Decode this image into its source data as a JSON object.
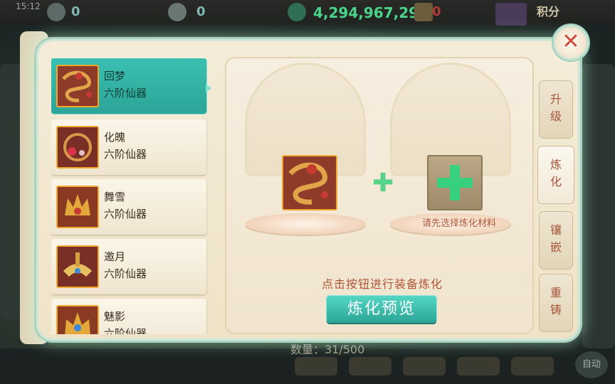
{
  "status_bar": {
    "time": "15:12",
    "currency_a": "0",
    "currency_b": "0",
    "gold": "4,294,967,295",
    "red_currency": "0",
    "points_label": "积分"
  },
  "background": {
    "count_text": "数量：31/500",
    "auto_label": "自动"
  },
  "item_list": [
    {
      "name": "回梦",
      "grade": "六阶仙器",
      "selected": true
    },
    {
      "name": "化魄",
      "grade": "六阶仙器",
      "selected": false
    },
    {
      "name": "舞雪",
      "grade": "六阶仙器",
      "selected": false
    },
    {
      "name": "邀月",
      "grade": "六阶仙器",
      "selected": false
    },
    {
      "name": "魅影",
      "grade": "六阶仙器",
      "selected": false
    }
  ],
  "refine": {
    "material_hint": "请先选择炼化材料",
    "action_hint": "点击按钮进行装备炼化",
    "preview_button": "炼化预览"
  },
  "tabs": [
    {
      "line1": "升",
      "line2": "级",
      "active": false
    },
    {
      "line1": "炼",
      "line2": "化",
      "active": true
    },
    {
      "line1": "镶",
      "line2": "嵌",
      "active": false
    },
    {
      "line1": "重",
      "line2": "铸",
      "active": false
    }
  ],
  "colors": {
    "accent_teal": "#2ba597",
    "gold_text": "#49d489",
    "hint_text": "#b0563a",
    "equip_border": "#f0a830"
  },
  "icons": {
    "close": "close-icon",
    "plus": "plus-icon"
  }
}
